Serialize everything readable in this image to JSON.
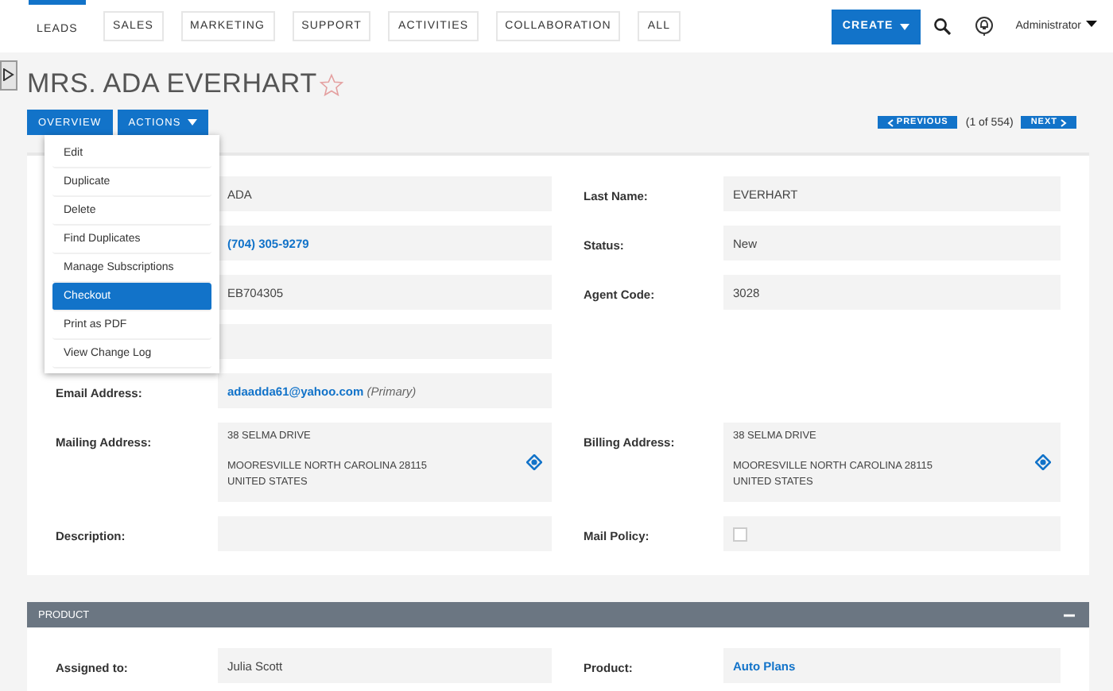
{
  "nav": {
    "tabs": [
      {
        "label": "LEADS",
        "selected": true
      },
      {
        "label": "SALES",
        "selected": false
      },
      {
        "label": "MARKETING",
        "selected": false
      },
      {
        "label": "SUPPORT",
        "selected": false
      },
      {
        "label": "ACTIVITIES",
        "selected": false
      },
      {
        "label": "COLLABORATION",
        "selected": false
      },
      {
        "label": "ALL",
        "selected": false
      }
    ],
    "create_button": "CREATE",
    "user_menu": "Administrator"
  },
  "record": {
    "title": "MRS. ADA EVERHART",
    "favorite": false
  },
  "view_tabs": [
    {
      "label": "OVERVIEW",
      "kind": "tab"
    },
    {
      "label": "ACTIONS",
      "kind": "dropdown"
    }
  ],
  "actions_menu": [
    {
      "label": "Edit",
      "selected": false
    },
    {
      "label": "Duplicate",
      "selected": false
    },
    {
      "label": "Delete",
      "selected": false
    },
    {
      "label": "Find Duplicates",
      "selected": false
    },
    {
      "label": "Manage Subscriptions",
      "selected": false
    },
    {
      "label": "Checkout",
      "selected": true
    },
    {
      "label": "Print as PDF",
      "selected": false
    },
    {
      "label": "View Change Log",
      "selected": false
    }
  ],
  "pagination": {
    "previous": "PREVIOUS",
    "count": "(1 of 554)",
    "next": "NEXT"
  },
  "fields": [
    [
      {
        "kind": "text",
        "value": "ADA"
      },
      {
        "kind": "text",
        "label": "Last Name:",
        "value": "EVERHART"
      }
    ],
    [
      {
        "kind": "link",
        "value": "(704) 305-9279"
      },
      {
        "kind": "text",
        "label": "Status:",
        "value": "New"
      }
    ],
    [
      {
        "kind": "text",
        "value": "EB704305"
      },
      {
        "kind": "text",
        "label": "Agent Code:",
        "value": "3028"
      }
    ],
    [
      {
        "kind": "text"
      },
      {
        "kind": "none"
      }
    ],
    [
      {
        "kind": "link",
        "label": "Email Address:",
        "value": "adaadda61@yahoo.com",
        "note": "(Primary)"
      },
      {
        "kind": "none"
      }
    ],
    [
      {
        "kind": "address",
        "label": "Mailing Address:",
        "lines": [
          "38 SELMA DRIVE",
          "MOORESVILLE NORTH CAROLINA   28115",
          "UNITED STATES"
        ]
      },
      {
        "kind": "address",
        "label": "Billing Address:",
        "lines": [
          "38 SELMA DRIVE",
          "MOORESVILLE NORTH CAROLINA   28115",
          "UNITED STATES"
        ]
      }
    ],
    [
      {
        "kind": "text",
        "label": "Description:"
      },
      {
        "kind": "checkbox",
        "label": "Mail Policy:",
        "checked": false
      }
    ]
  ],
  "section": {
    "title": "PRODUCT",
    "expanded": true,
    "fields": [
      [
        {
          "kind": "text",
          "label": "Assigned to:",
          "value": "Julia Scott"
        },
        {
          "kind": "link",
          "label": "Product:",
          "value": "Auto Plans"
        }
      ]
    ]
  }
}
